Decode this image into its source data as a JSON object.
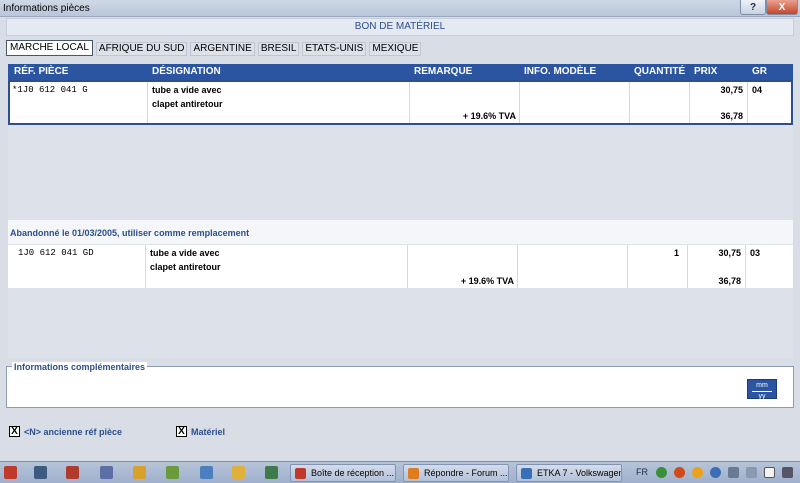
{
  "window": {
    "title": "Informations pièces",
    "help_label": "?",
    "close_label": "X"
  },
  "section_title": "BON DE MATÉRIEL",
  "tabs": [
    {
      "label": "MARCHE LOCAL",
      "active": true
    },
    {
      "label": "AFRIQUE DU SUD"
    },
    {
      "label": "ARGENTINE"
    },
    {
      "label": "BRESIL"
    },
    {
      "label": "ETATS-UNIS"
    },
    {
      "label": "MEXIQUE"
    }
  ],
  "table": {
    "columns": [
      "RÉF. PIÈCE",
      "DÉSIGNATION",
      "REMARQUE",
      "INFO. MODÈLE",
      "QUANTITÉ",
      "PRIX",
      "GR"
    ],
    "rows": [
      {
        "ref": "*1J0 612 041 G",
        "designation_line1": "tube a vide avec",
        "designation_line2": "clapet antiretour",
        "remarque": "+ 19.6% TVA",
        "info_modele": "",
        "quantite": "",
        "prix": "30,75",
        "prix_tva": "36,78",
        "gr": "04"
      }
    ]
  },
  "replacement": {
    "message": "Abandonné le 01/03/2005, utiliser comme remplacement",
    "row": {
      "ref": "1J0 612 041 GD",
      "designation_line1": "tube a vide avec",
      "designation_line2": "clapet antiretour",
      "remarque": "+ 19.6% TVA",
      "info_modele": "",
      "quantite": "1",
      "prix": "30,75",
      "prix_tva": "36,78",
      "gr": "03"
    }
  },
  "info_section": {
    "label": "Informations complémentaires",
    "mmyy_top": "mm",
    "mmyy_bottom": "yy"
  },
  "checkboxes": [
    {
      "label": "<N> ancienne réf pièce",
      "checked": true,
      "mark": "X"
    },
    {
      "label": "Matériel",
      "checked": true,
      "mark": "X"
    }
  ],
  "taskbar": {
    "items": [
      {
        "label": "Boîte de réception ...",
        "icon": "mail-icon"
      },
      {
        "label": "Répondre - Forum ...",
        "icon": "firefox-icon"
      },
      {
        "label": "ETKA 7 - Volkswagen",
        "icon": "app-icon"
      }
    ],
    "language": "FR"
  }
}
